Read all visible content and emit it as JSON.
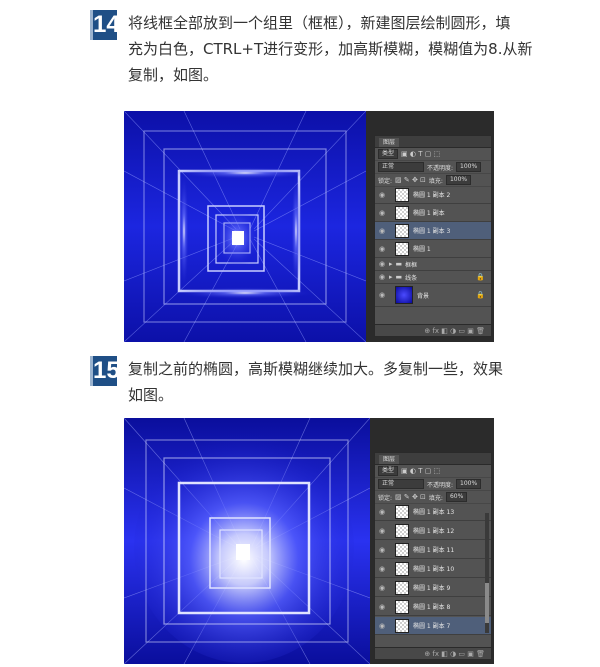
{
  "steps": [
    {
      "number": "14",
      "text": "将线框全部放到一个组里（框框），新建图层绘制圆形，填充为白色，CTRL+T进行变形，加高斯模糊，模糊值为8.从新复制，如图。",
      "lines": [
        "将线框全部放到一个组里（框框），新建图层绘制圆形，填",
        "充为白色，CTRL+T进行变形，加高斯模糊，模糊值为8.从新",
        "复制，如图。"
      ]
    },
    {
      "number": "15",
      "text": "复制之前的椭圆，高斯模糊继续加大。多复制一些，效果如图。",
      "lines": [
        "复制之前的椭圆，高斯模糊继续加大。多复制一些，效果",
        "如图。"
      ]
    }
  ],
  "panel1": {
    "tab": "图层",
    "kind": "类型",
    "blend": "正常",
    "opacity_label": "不透明度:",
    "opacity": "100%",
    "lock_label": "锁定:",
    "fill_label": "填充:",
    "fill": "100%",
    "layers": [
      {
        "name": "椭圆 1 副本 2",
        "selected": false,
        "thumb": "check"
      },
      {
        "name": "椭圆 1 副本",
        "selected": false,
        "thumb": "check"
      },
      {
        "name": "椭圆 1 副本 3",
        "selected": true,
        "thumb": "check"
      },
      {
        "name": "椭圆 1",
        "selected": false,
        "thumb": "check"
      },
      {
        "name": "框框",
        "selected": false,
        "thumb": "folder"
      },
      {
        "name": "线条",
        "selected": false,
        "thumb": "folder"
      },
      {
        "name": "背景",
        "selected": false,
        "thumb": "blue"
      }
    ]
  },
  "panel2": {
    "tab": "图层",
    "kind": "类型",
    "blend": "正常",
    "opacity_label": "不透明度:",
    "opacity": "100%",
    "lock_label": "锁定:",
    "fill_label": "填充:",
    "fill": "60%",
    "layers": [
      {
        "name": "椭圆 1 副本 13",
        "selected": false
      },
      {
        "name": "椭圆 1 副本 12",
        "selected": false
      },
      {
        "name": "椭圆 1 副本 11",
        "selected": false
      },
      {
        "name": "椭圆 1 副本 10",
        "selected": false
      },
      {
        "name": "椭圆 1 副本 9",
        "selected": false
      },
      {
        "name": "椭圆 1 副本 8",
        "selected": false
      },
      {
        "name": "椭圆 1 副本 7",
        "selected": true
      }
    ]
  },
  "icons": {
    "eye": "eye-icon",
    "folder": "folder-icon",
    "lock": "lock-icon",
    "collapse": "collapse-arrow-icon"
  },
  "colors": {
    "step_badge": "#1f4f86",
    "canvas_blue": "#1218c8",
    "panel_bg": "#535353",
    "selected_layer": "#4f5f7a"
  }
}
